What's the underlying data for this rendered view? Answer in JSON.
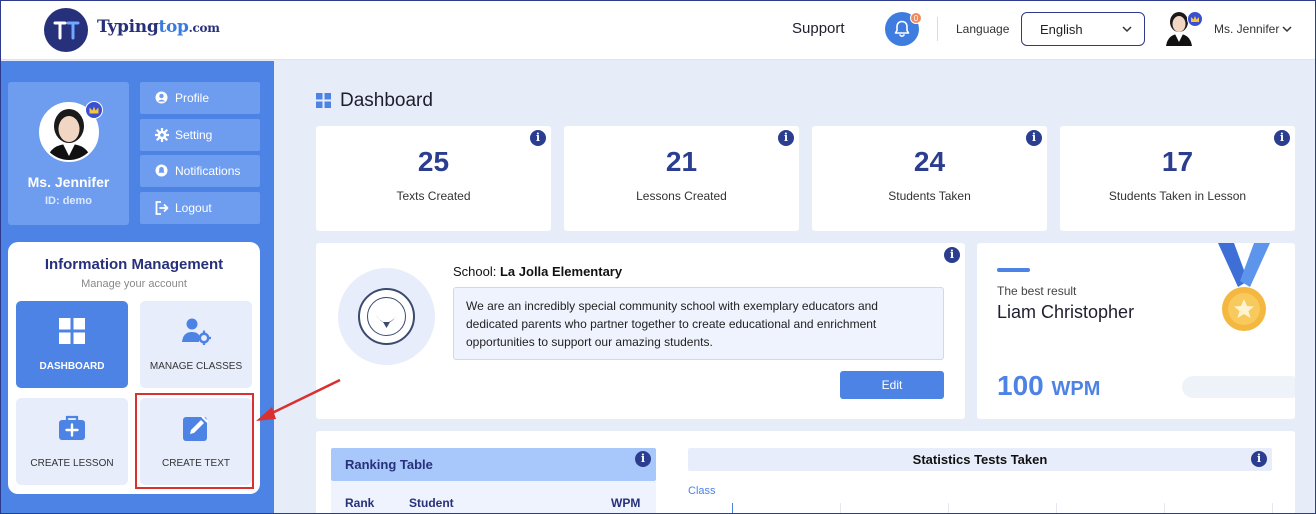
{
  "header": {
    "logo_word": "Typing",
    "logo_accent": "top",
    "logo_domain": ".com",
    "support": "Support",
    "notification_count": "0",
    "language_label": "Language",
    "language_value": "English",
    "user_name": "Ms. Jennifer"
  },
  "sidebar": {
    "profile_name": "Ms. Jennifer",
    "profile_id": "ID: demo",
    "menu": [
      {
        "label": "Profile",
        "icon": "user-circle-icon"
      },
      {
        "label": "Setting",
        "icon": "gear-icon"
      },
      {
        "label": "Notifications",
        "icon": "bell-icon"
      },
      {
        "label": "Logout",
        "icon": "logout-icon"
      }
    ],
    "info_title": "Information Management",
    "info_subtitle": "Manage your account",
    "tiles": [
      {
        "label": "DASHBOARD",
        "icon": "dashboard-grid-icon",
        "active": true
      },
      {
        "label": "MANAGE CLASSES",
        "icon": "manage-users-icon",
        "active": false
      },
      {
        "label": "CREATE LESSON",
        "icon": "briefcase-plus-icon",
        "active": false
      },
      {
        "label": "CREATE TEXT",
        "icon": "edit-icon",
        "active": false
      }
    ]
  },
  "main": {
    "title": "Dashboard",
    "stats": [
      {
        "value": "25",
        "label": "Texts Created"
      },
      {
        "value": "21",
        "label": "Lessons Created"
      },
      {
        "value": "24",
        "label": "Students Taken"
      },
      {
        "value": "17",
        "label": "Students Taken in Lesson"
      }
    ],
    "school": {
      "prefix": "School: ",
      "name": "La Jolla Elementary",
      "description": "We are an incredibly special community school with exemplary educators and dedicated parents who partner together to create educational and enrichment opportunities to support our amazing students.",
      "edit_label": "Edit"
    },
    "best": {
      "label": "The best result",
      "name": "Liam Christopher",
      "value": "100",
      "unit": "WPM"
    },
    "ranking": {
      "title": "Ranking Table",
      "columns": [
        "Rank",
        "Student",
        "WPM"
      ]
    },
    "statistics": {
      "title": "Statistics Tests Taken",
      "axis_label": "Class"
    }
  },
  "colors": {
    "brand_navy": "#27307a",
    "accent_blue": "#4c83e4",
    "background": "#e7edf8",
    "highlight_red": "#d93030"
  }
}
